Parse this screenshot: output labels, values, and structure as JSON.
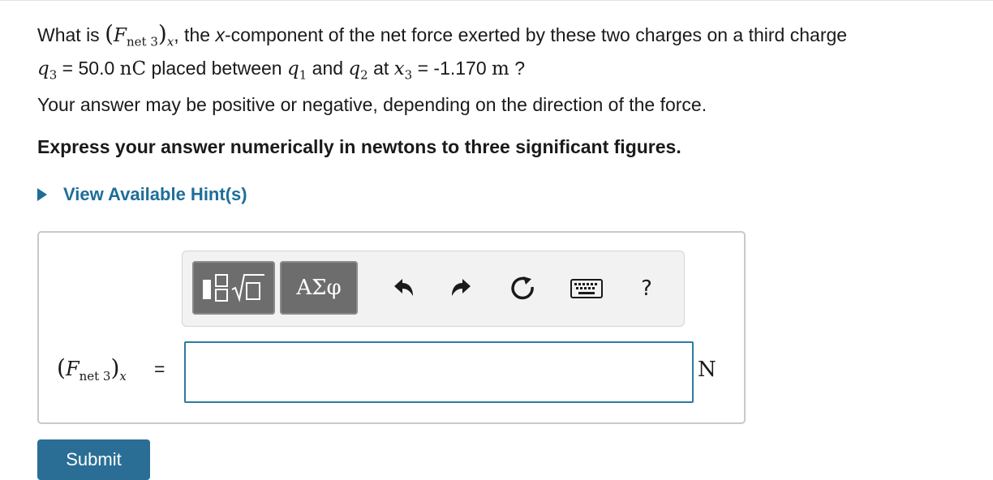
{
  "question": {
    "prefix": "What is ",
    "var_F": "F",
    "var_sub": "net 3",
    "var_comp": "x",
    "middle": ", the ",
    "x_word": "x",
    "rest1": "-component of the net force exerted by these two charges on a third charge",
    "q3": "q",
    "q3_sub": "3",
    "eq1": " = 50.0 ",
    "unit_nC": "nC",
    "placed": " placed between ",
    "q1": "q",
    "q1_sub": "1",
    "and": " and ",
    "q2": "q",
    "q2_sub": "2",
    "at": " at ",
    "x3": "x",
    "x3_sub": "3",
    "eq2": " = -1.170 ",
    "unit_m": "m",
    "qmark": " ?"
  },
  "note": "Your answer may be positive or negative, depending on the direction of the force.",
  "instruction": "Express your answer numerically in newtons to three significant figures.",
  "hint_label": "View Available Hint(s)",
  "toolbar": {
    "symbols_label": "ΑΣφ",
    "help_label": "?",
    "icons": [
      "templates-icon",
      "greek-symbols-icon",
      "undo-icon",
      "redo-icon",
      "reset-icon",
      "keyboard-icon",
      "help-icon"
    ]
  },
  "answer": {
    "label_F": "F",
    "label_sub": "net 3",
    "label_comp": "x",
    "equals": "=",
    "value": "",
    "unit": "N"
  },
  "submit_label": "Submit",
  "colors": {
    "link": "#1e6e9a",
    "toolbar_button": "#6d6d6d",
    "input_border": "#2c7ba3",
    "submit_bg": "#2a6e96"
  }
}
